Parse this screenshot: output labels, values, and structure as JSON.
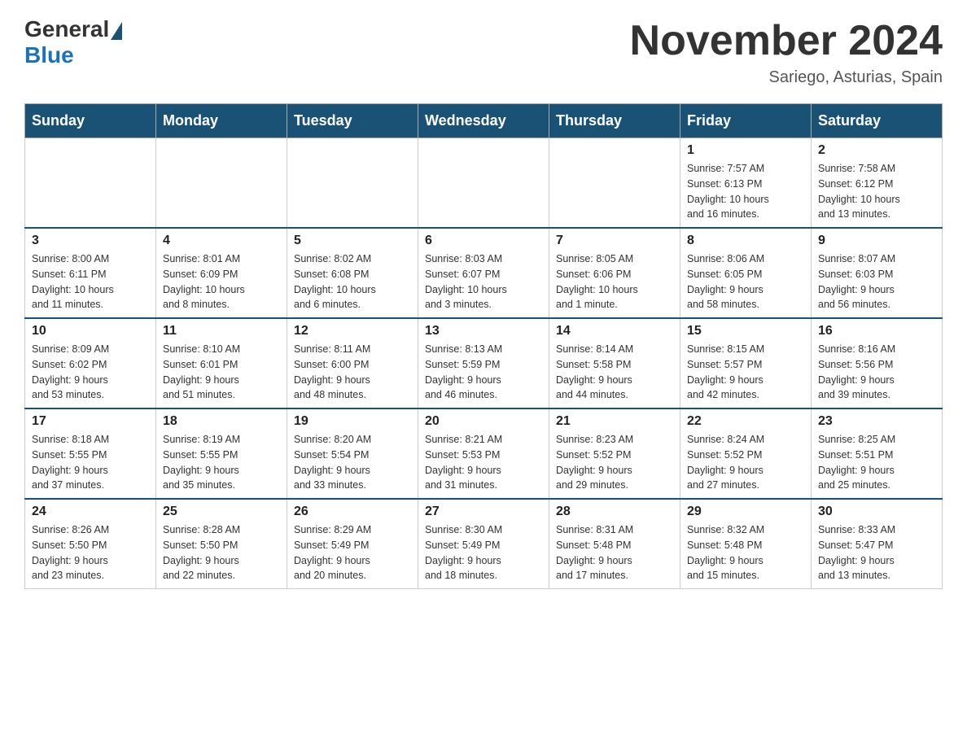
{
  "header": {
    "logo": {
      "general": "General",
      "blue": "Blue"
    },
    "title": "November 2024",
    "location": "Sariego, Asturias, Spain"
  },
  "days_of_week": [
    "Sunday",
    "Monday",
    "Tuesday",
    "Wednesday",
    "Thursday",
    "Friday",
    "Saturday"
  ],
  "weeks": [
    {
      "days": [
        {
          "number": "",
          "info": ""
        },
        {
          "number": "",
          "info": ""
        },
        {
          "number": "",
          "info": ""
        },
        {
          "number": "",
          "info": ""
        },
        {
          "number": "",
          "info": ""
        },
        {
          "number": "1",
          "info": "Sunrise: 7:57 AM\nSunset: 6:13 PM\nDaylight: 10 hours\nand 16 minutes."
        },
        {
          "number": "2",
          "info": "Sunrise: 7:58 AM\nSunset: 6:12 PM\nDaylight: 10 hours\nand 13 minutes."
        }
      ]
    },
    {
      "days": [
        {
          "number": "3",
          "info": "Sunrise: 8:00 AM\nSunset: 6:11 PM\nDaylight: 10 hours\nand 11 minutes."
        },
        {
          "number": "4",
          "info": "Sunrise: 8:01 AM\nSunset: 6:09 PM\nDaylight: 10 hours\nand 8 minutes."
        },
        {
          "number": "5",
          "info": "Sunrise: 8:02 AM\nSunset: 6:08 PM\nDaylight: 10 hours\nand 6 minutes."
        },
        {
          "number": "6",
          "info": "Sunrise: 8:03 AM\nSunset: 6:07 PM\nDaylight: 10 hours\nand 3 minutes."
        },
        {
          "number": "7",
          "info": "Sunrise: 8:05 AM\nSunset: 6:06 PM\nDaylight: 10 hours\nand 1 minute."
        },
        {
          "number": "8",
          "info": "Sunrise: 8:06 AM\nSunset: 6:05 PM\nDaylight: 9 hours\nand 58 minutes."
        },
        {
          "number": "9",
          "info": "Sunrise: 8:07 AM\nSunset: 6:03 PM\nDaylight: 9 hours\nand 56 minutes."
        }
      ]
    },
    {
      "days": [
        {
          "number": "10",
          "info": "Sunrise: 8:09 AM\nSunset: 6:02 PM\nDaylight: 9 hours\nand 53 minutes."
        },
        {
          "number": "11",
          "info": "Sunrise: 8:10 AM\nSunset: 6:01 PM\nDaylight: 9 hours\nand 51 minutes."
        },
        {
          "number": "12",
          "info": "Sunrise: 8:11 AM\nSunset: 6:00 PM\nDaylight: 9 hours\nand 48 minutes."
        },
        {
          "number": "13",
          "info": "Sunrise: 8:13 AM\nSunset: 5:59 PM\nDaylight: 9 hours\nand 46 minutes."
        },
        {
          "number": "14",
          "info": "Sunrise: 8:14 AM\nSunset: 5:58 PM\nDaylight: 9 hours\nand 44 minutes."
        },
        {
          "number": "15",
          "info": "Sunrise: 8:15 AM\nSunset: 5:57 PM\nDaylight: 9 hours\nand 42 minutes."
        },
        {
          "number": "16",
          "info": "Sunrise: 8:16 AM\nSunset: 5:56 PM\nDaylight: 9 hours\nand 39 minutes."
        }
      ]
    },
    {
      "days": [
        {
          "number": "17",
          "info": "Sunrise: 8:18 AM\nSunset: 5:55 PM\nDaylight: 9 hours\nand 37 minutes."
        },
        {
          "number": "18",
          "info": "Sunrise: 8:19 AM\nSunset: 5:55 PM\nDaylight: 9 hours\nand 35 minutes."
        },
        {
          "number": "19",
          "info": "Sunrise: 8:20 AM\nSunset: 5:54 PM\nDaylight: 9 hours\nand 33 minutes."
        },
        {
          "number": "20",
          "info": "Sunrise: 8:21 AM\nSunset: 5:53 PM\nDaylight: 9 hours\nand 31 minutes."
        },
        {
          "number": "21",
          "info": "Sunrise: 8:23 AM\nSunset: 5:52 PM\nDaylight: 9 hours\nand 29 minutes."
        },
        {
          "number": "22",
          "info": "Sunrise: 8:24 AM\nSunset: 5:52 PM\nDaylight: 9 hours\nand 27 minutes."
        },
        {
          "number": "23",
          "info": "Sunrise: 8:25 AM\nSunset: 5:51 PM\nDaylight: 9 hours\nand 25 minutes."
        }
      ]
    },
    {
      "days": [
        {
          "number": "24",
          "info": "Sunrise: 8:26 AM\nSunset: 5:50 PM\nDaylight: 9 hours\nand 23 minutes."
        },
        {
          "number": "25",
          "info": "Sunrise: 8:28 AM\nSunset: 5:50 PM\nDaylight: 9 hours\nand 22 minutes."
        },
        {
          "number": "26",
          "info": "Sunrise: 8:29 AM\nSunset: 5:49 PM\nDaylight: 9 hours\nand 20 minutes."
        },
        {
          "number": "27",
          "info": "Sunrise: 8:30 AM\nSunset: 5:49 PM\nDaylight: 9 hours\nand 18 minutes."
        },
        {
          "number": "28",
          "info": "Sunrise: 8:31 AM\nSunset: 5:48 PM\nDaylight: 9 hours\nand 17 minutes."
        },
        {
          "number": "29",
          "info": "Sunrise: 8:32 AM\nSunset: 5:48 PM\nDaylight: 9 hours\nand 15 minutes."
        },
        {
          "number": "30",
          "info": "Sunrise: 8:33 AM\nSunset: 5:47 PM\nDaylight: 9 hours\nand 13 minutes."
        }
      ]
    }
  ]
}
